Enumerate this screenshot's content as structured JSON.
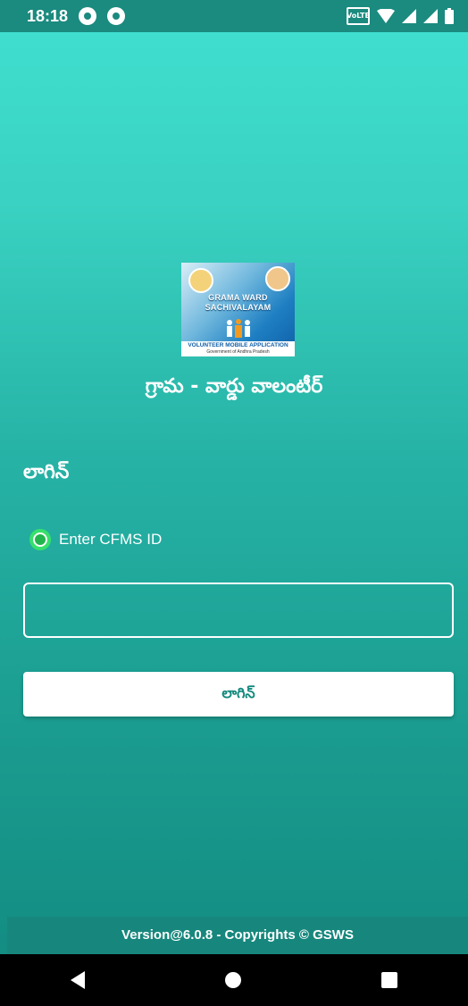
{
  "status_bar": {
    "time": "18:18",
    "volte_label": "VoLTE",
    "icons": [
      "notification-icon",
      "notification-icon",
      "volte-icon",
      "wifi-icon",
      "signal-icon",
      "signal-icon",
      "battery-icon"
    ]
  },
  "logo": {
    "title_line1": "GRAMA WARD",
    "title_line2": "SACHIVALAYAM",
    "footer_line1": "VOLUNTEER MOBILE APPLICATION",
    "footer_line2": "Government of Andhra Pradesh"
  },
  "app_title": "గ్రామ - వార్డు వాలంటీర్",
  "login_heading": "లాగిన్",
  "radio_option": {
    "label": "Enter CFMS ID",
    "selected": true
  },
  "cfms_input": {
    "value": "",
    "placeholder": ""
  },
  "login_button": {
    "label": "లాగిన్"
  },
  "footer": {
    "version_text": "Version@6.0.8 - Copyrights © GSWS"
  },
  "colors": {
    "accent_teal": "#1b8a7f",
    "radio_green": "#37e06b",
    "button_text": "#158a7e"
  }
}
